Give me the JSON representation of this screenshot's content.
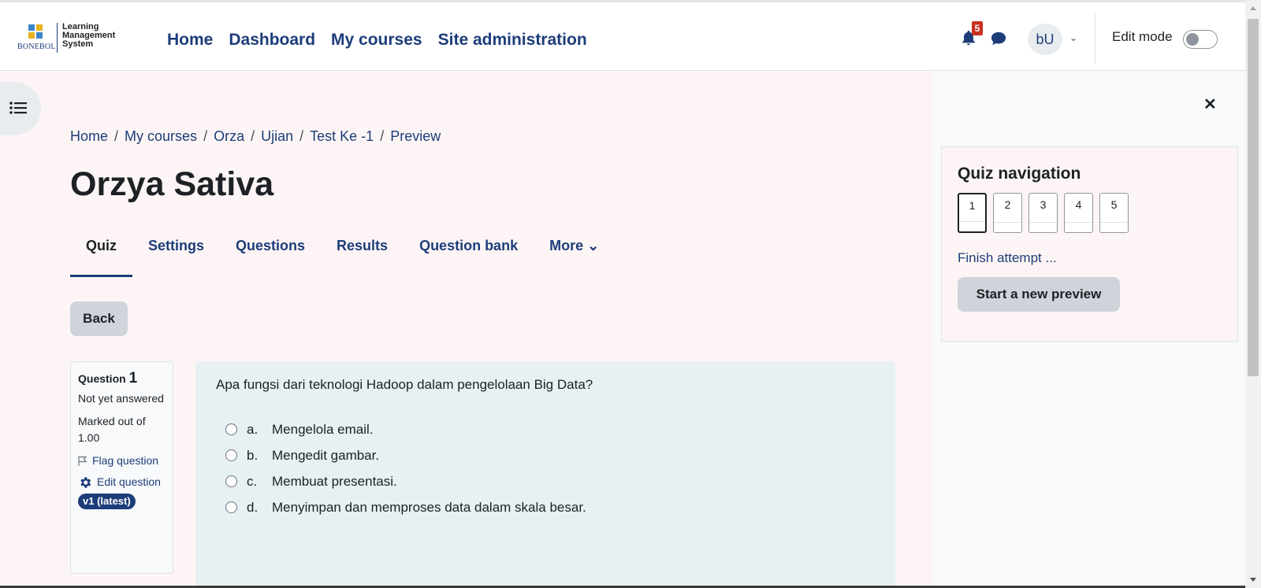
{
  "brand": {
    "name": "BONEBOL",
    "title_line1": "Learning",
    "title_line2": "Management",
    "title_line3": "System"
  },
  "primary_nav": [
    "Home",
    "Dashboard",
    "My courses",
    "Site administration"
  ],
  "notifications": {
    "count": "5"
  },
  "user": {
    "initials": "bU"
  },
  "edit_mode": {
    "label": "Edit mode",
    "on": false
  },
  "breadcrumb": [
    "Home",
    "My courses",
    "Orza",
    "Ujian",
    "Test Ke -1",
    "Preview"
  ],
  "page_title": "Orzya Sativa",
  "tabs": [
    {
      "label": "Quiz",
      "active": true
    },
    {
      "label": "Settings"
    },
    {
      "label": "Questions"
    },
    {
      "label": "Results"
    },
    {
      "label": "Question bank"
    },
    {
      "label": "More ⌄"
    }
  ],
  "back_label": "Back",
  "question_info": {
    "prefix": "Question",
    "number": "1",
    "state": "Not yet answered",
    "grade": "Marked out of 1.00",
    "flag_label": "Flag question",
    "edit_label": "Edit question",
    "version": "v1 (latest)"
  },
  "question": {
    "text": "Apa fungsi dari teknologi Hadoop dalam pengelolaan Big Data?",
    "answers": [
      {
        "letter": "a.",
        "text": "Mengelola email."
      },
      {
        "letter": "b.",
        "text": "Mengedit gambar."
      },
      {
        "letter": "c.",
        "text": "Membuat presentasi."
      },
      {
        "letter": "d.",
        "text": "Menyimpan dan memproses data dalam skala besar."
      }
    ]
  },
  "quiz_navigation": {
    "title": "Quiz navigation",
    "questions": [
      "1",
      "2",
      "3",
      "4",
      "5"
    ],
    "current": "1",
    "finish_label": "Finish attempt ...",
    "new_preview_label": "Start a new preview"
  },
  "colors": {
    "primary": "#1d3d7a",
    "badge": "#ca3120",
    "page_bg": "#fdf5f5",
    "question_bg": "#e7f0f3"
  }
}
